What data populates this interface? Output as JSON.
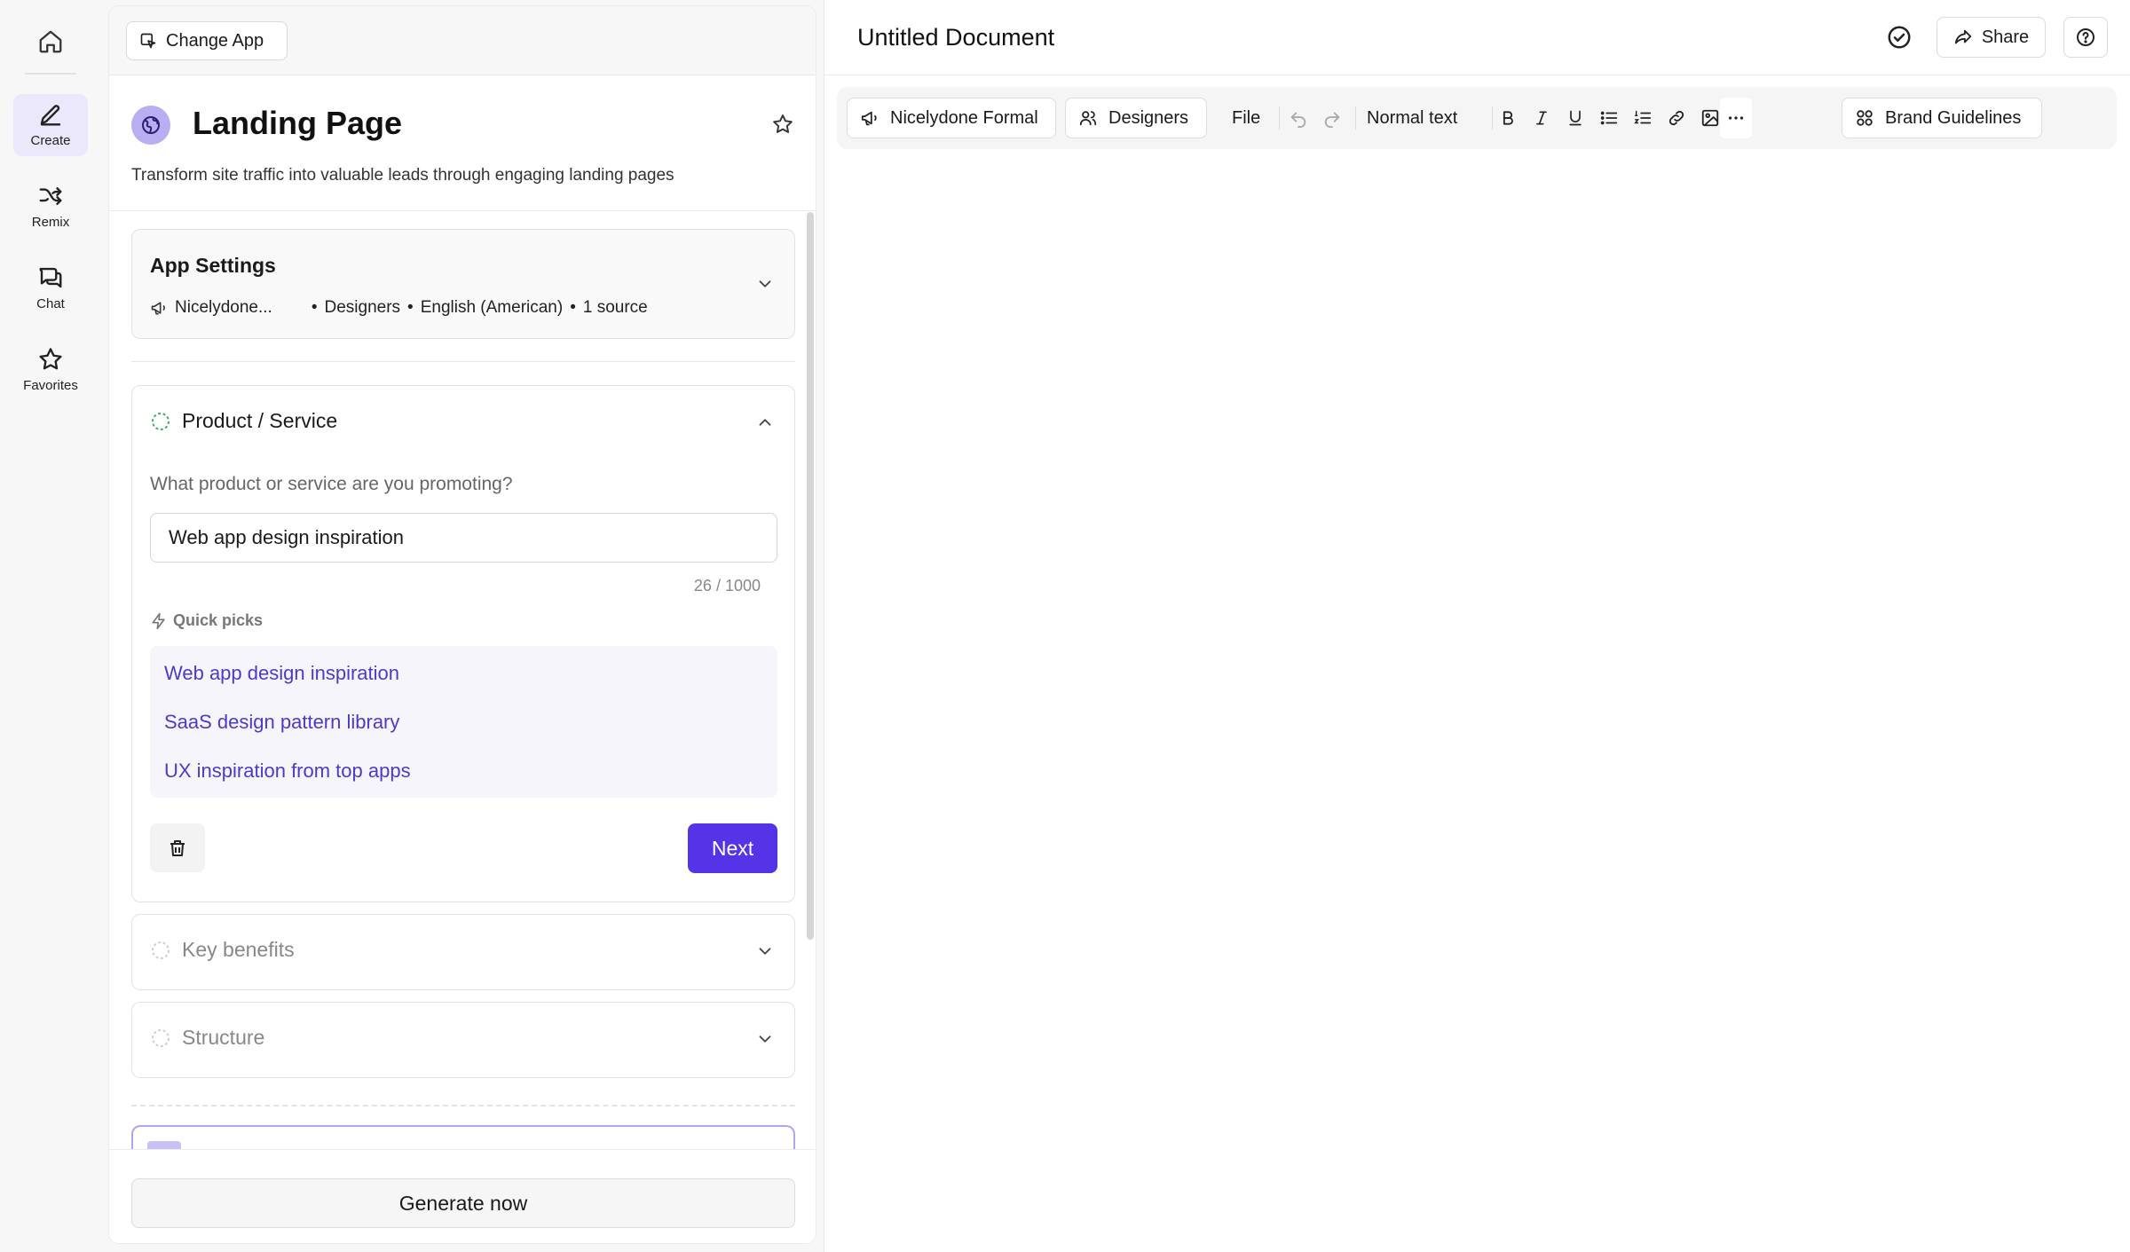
{
  "rail": {
    "items": [
      {
        "label": "Create",
        "icon": "pen-icon",
        "active": true
      },
      {
        "label": "Remix",
        "icon": "shuffle-icon",
        "active": false
      },
      {
        "label": "Chat",
        "icon": "chat-icon",
        "active": false
      },
      {
        "label": "Favorites",
        "icon": "star-icon",
        "active": false
      }
    ]
  },
  "panel": {
    "change_app_label": "Change App",
    "title": "Landing Page",
    "description": "Transform site traffic into valuable leads through engaging landing pages",
    "settings": {
      "title": "App Settings",
      "brand_voice": "Nicelydone...",
      "audience": "Designers",
      "language": "English (American)",
      "sources": "1 source"
    },
    "product": {
      "title": "Product / Service",
      "question": "What product or service are you promoting?",
      "value": "Web app design inspiration",
      "counter": "26 / 1000",
      "quick_picks_label": "Quick picks",
      "quick_picks": [
        "Web app design inspiration",
        "SaaS design pattern library",
        "UX inspiration from top apps"
      ],
      "next_label": "Next"
    },
    "key_benefits_title": "Key benefits",
    "structure_title": "Structure",
    "generate_label": "Generate now"
  },
  "editor": {
    "doc_title": "Untitled Document",
    "share_label": "Share",
    "toolbar": {
      "brand_voice": "Nicelydone Formal",
      "audience": "Designers",
      "file": "File",
      "text_style": "Normal text",
      "brand_guidelines": "Brand Guidelines"
    }
  },
  "colors": {
    "accent": "#5533e6",
    "accent_light": "#ebe8fb",
    "link": "#4b3bc9",
    "progress_green": "#3fae6a"
  }
}
